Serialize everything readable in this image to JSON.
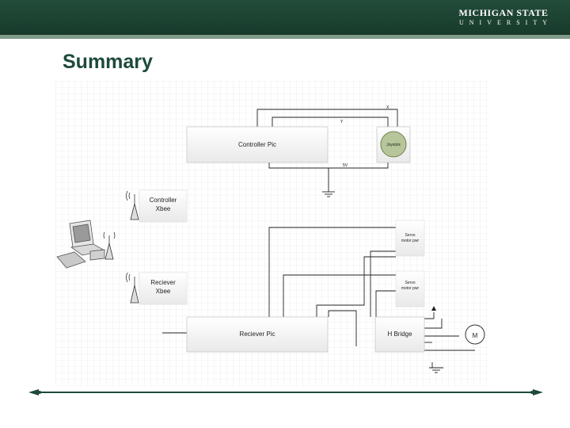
{
  "header": {
    "brand_line1": "MICHIGAN STATE",
    "brand_line2": "UNIVERSITY"
  },
  "slide": {
    "title": "Summary"
  },
  "diagram": {
    "controller_pic": "Controller Pic",
    "joystick": "Joystick",
    "controller_xbee_line1": "Controller",
    "controller_xbee_line2": "Xbee",
    "receiver_xbee_line1": "Reciever",
    "receiver_xbee_line2": "Xbee",
    "receiver_pic": "Reciever Pic",
    "h_bridge": "H Bridge",
    "motor": "M",
    "servo1_line1": "Servo",
    "servo1_line2": "motor pwr",
    "servo2_line1": "Servo",
    "servo2_line2": "motor pwr",
    "wire_x": "X",
    "wire_y": "Y",
    "wire_5v": "5V"
  }
}
